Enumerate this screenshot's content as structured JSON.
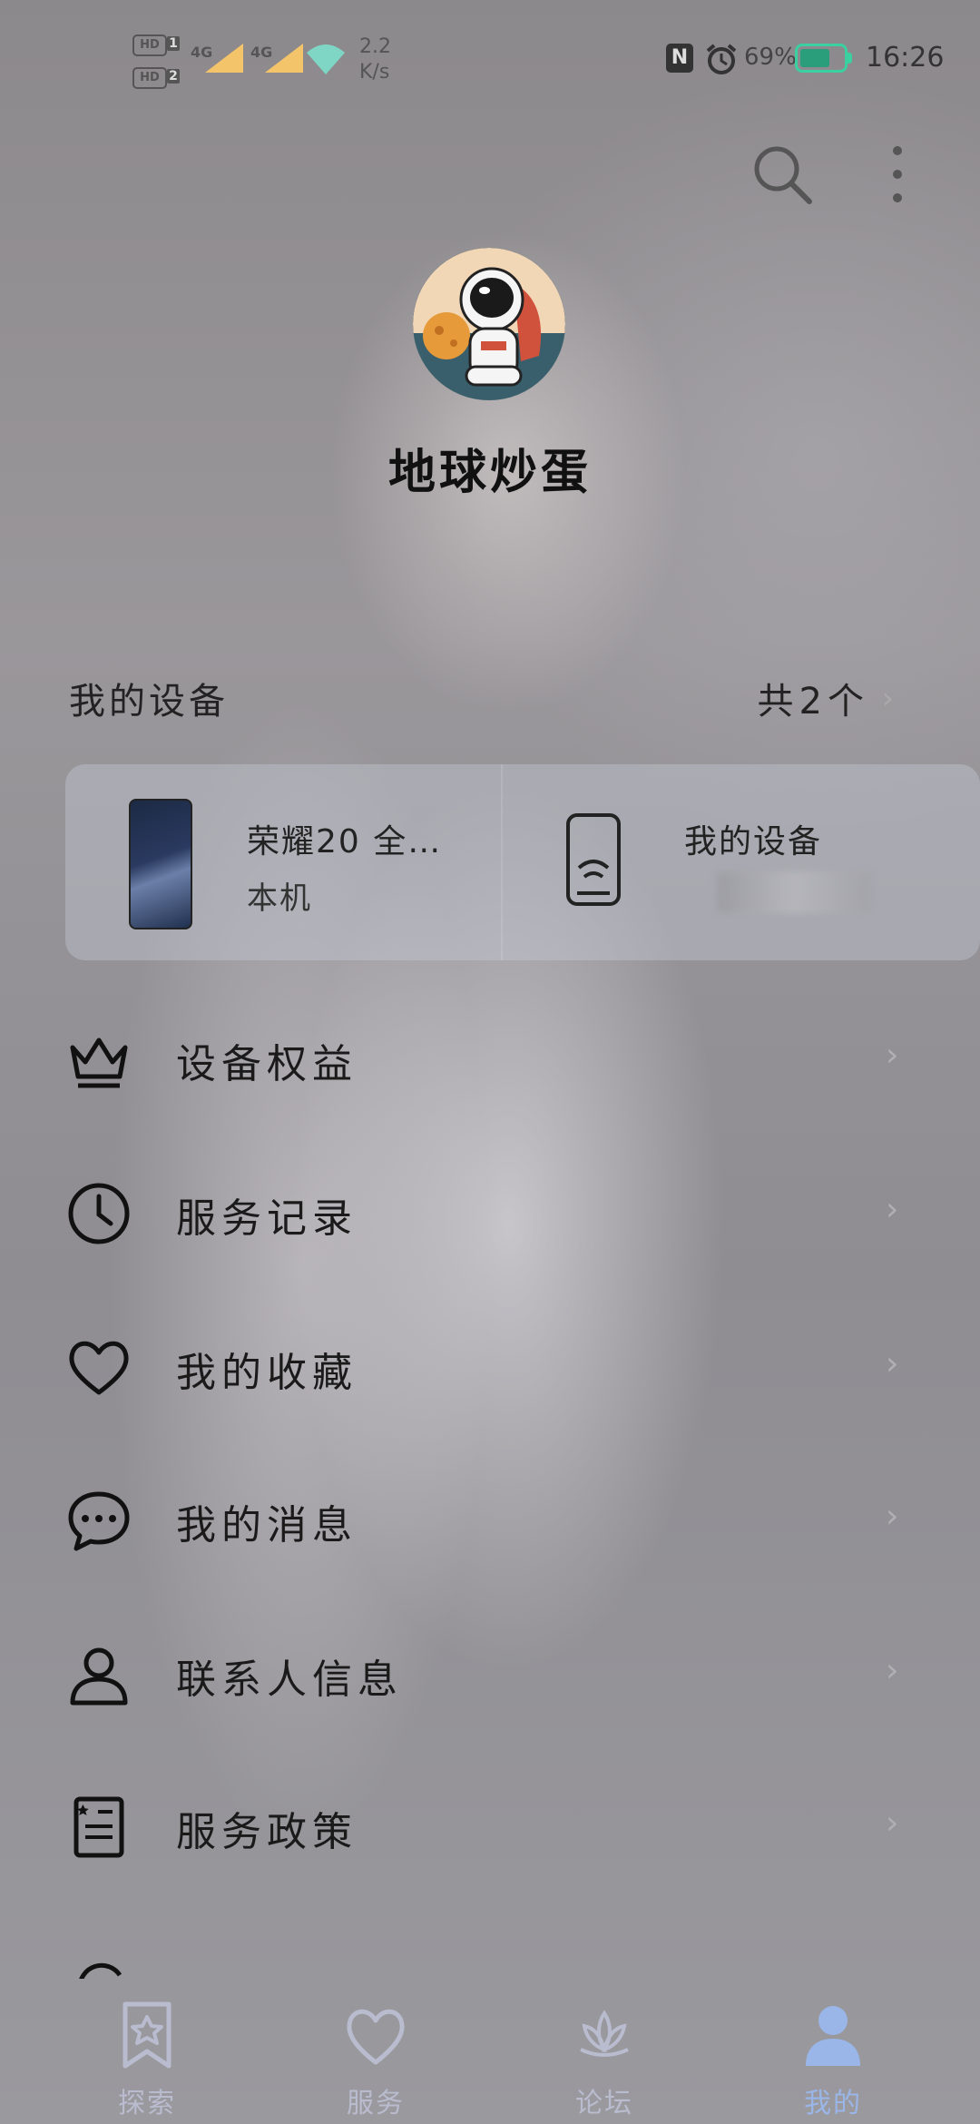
{
  "status_bar": {
    "sim1_badge": "HD",
    "sim1_num": "1",
    "sim2_badge": "HD",
    "sim2_num": "2",
    "net1": "4G",
    "net2": "4G",
    "speed_value": "2.2",
    "speed_unit": "K/s",
    "nfc_label": "N",
    "battery_percent": "69%",
    "time": "16:26",
    "icons": [
      "nfc-icon",
      "alarm-icon",
      "battery-icon",
      "wifi-icon",
      "signal-icon"
    ]
  },
  "header": {
    "icons": [
      "search-icon",
      "more-vertical-icon"
    ]
  },
  "profile": {
    "name": "地球炒蛋",
    "avatar_icon": "astronaut-avatar"
  },
  "devices": {
    "label": "我的设备",
    "count": "共2个",
    "items": [
      {
        "title": "荣耀20 全…",
        "subtitle": "本机",
        "icon": "phone-thumbnail"
      },
      {
        "title": "我的设备",
        "subtitle": "",
        "icon": "device-wifi-icon"
      }
    ]
  },
  "menu": [
    {
      "label": "设备权益",
      "icon": "crown-icon"
    },
    {
      "label": "服务记录",
      "icon": "clock-icon"
    },
    {
      "label": "我的收藏",
      "icon": "heart-icon"
    },
    {
      "label": "我的消息",
      "icon": "chat-bubble-icon"
    },
    {
      "label": "联系人信息",
      "icon": "person-icon"
    },
    {
      "label": "服务政策",
      "icon": "document-icon"
    }
  ],
  "tabs": [
    {
      "label": "探索",
      "icon": "bookmark-star-icon"
    },
    {
      "label": "服务",
      "icon": "heart-outline-icon"
    },
    {
      "label": "论坛",
      "icon": "lotus-icon"
    },
    {
      "label": "我的",
      "icon": "user-icon",
      "active": true
    }
  ],
  "colors": {
    "accent_active_tab": "#9ab6e8",
    "inactive_tab": "#b9bccf",
    "battery": "#3ad0a0"
  }
}
